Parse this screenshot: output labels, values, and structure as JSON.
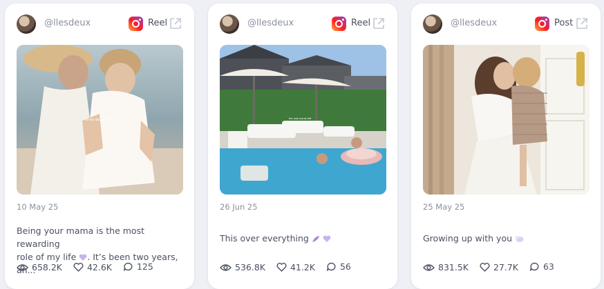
{
  "posts": [
    {
      "username": "@llesdeux",
      "type": "Reel",
      "platform_icon": "instagram-icon",
      "image_overlay_text": "to my daughter",
      "date": "10 May 25",
      "caption_line1": "Being your mama is the most rewarding",
      "caption_line2": "role of my life",
      "caption_line2_tail": ". It’s been two years, an...",
      "emoji": [
        "purple-heart-shell-icon"
      ],
      "views": "658.2K",
      "likes": "42.6K",
      "comments": "125"
    },
    {
      "username": "@llesdeux",
      "type": "Reel",
      "platform_icon": "instagram-icon",
      "image_overlay_line1": "the only words left",
      "image_overlay_line2": "I'll ever care about",
      "date": "26 Jun 25",
      "caption": "This over everything",
      "emoji": [
        "purple-feather-icon",
        "purple-heart-shell-icon"
      ],
      "views": "536.8K",
      "likes": "41.2K",
      "comments": "56"
    },
    {
      "username": "@llesdeux",
      "type": "Post",
      "platform_icon": "instagram-icon",
      "date": "25 May 25",
      "caption": "Growing up with you",
      "emoji": [
        "baby-bottle-icon"
      ],
      "views": "831.5K",
      "likes": "27.7K",
      "comments": "63"
    }
  ],
  "colors": {
    "background": "#eef0f5",
    "card": "#ffffff",
    "muted_text": "#8b909e",
    "body_text": "#4a5061"
  }
}
